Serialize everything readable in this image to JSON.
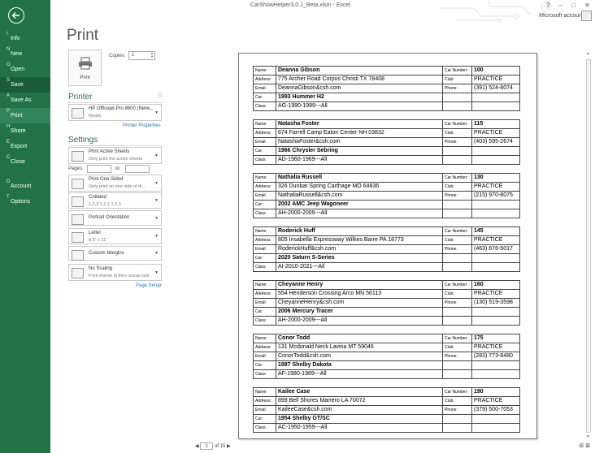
{
  "window": {
    "title": "CarShowHelper3.0.1_Beta.xlsm - Excel",
    "account": "Microsoft account",
    "controls": [
      "?",
      "–",
      "□",
      "✕"
    ]
  },
  "nav": {
    "items": [
      {
        "key": "I",
        "label": "Info"
      },
      {
        "key": "N",
        "label": "New"
      },
      {
        "key": "O",
        "label": "Open"
      },
      {
        "key": "S",
        "label": "Save"
      },
      {
        "key": "A",
        "label": "Save As"
      },
      {
        "key": "P",
        "label": "Print"
      },
      {
        "key": "H",
        "label": "Share"
      },
      {
        "key": "E",
        "label": "Export"
      },
      {
        "key": "C",
        "label": "Close"
      },
      {
        "key": "D",
        "label": "Account"
      },
      {
        "key": "T",
        "label": "Options"
      }
    ]
  },
  "print": {
    "title": "Print",
    "button_label": "Print",
    "copies_label": "Copies:",
    "copies_value": "1",
    "printer_heading": "Printer",
    "printer_name": "HP Officejet Pro 8600 (Netw...",
    "printer_status": "Ready",
    "printer_properties": "Printer Properties",
    "settings_heading": "Settings",
    "pages_label": "Pages:",
    "to_label": "to",
    "page_setup": "Page Setup",
    "settings": [
      {
        "t1": "Print Active Sheets",
        "t2": "Only print the active sheets"
      },
      {
        "t1": "Print One Sided",
        "t2": "Only print on one side of th..."
      },
      {
        "t1": "Collated",
        "t2": "1,2,3    1,2,3    1,2,3"
      },
      {
        "t1": "Portrait Orientation",
        "t2": ""
      },
      {
        "t1": "Letter",
        "t2": "8.5\" x 11\""
      },
      {
        "t1": "Custom Margins",
        "t2": ""
      },
      {
        "t1": "No Scaling",
        "t2": "Print sheets at their actual size"
      }
    ]
  },
  "preview": {
    "current_page": "1",
    "of_pages": "of 15",
    "labels": {
      "name": "Name:",
      "address": "Address:",
      "email": "Email:",
      "car": "Car:",
      "class": "Class:",
      "car_number": "Car Number:",
      "club": "Club:",
      "phone": "Phone:"
    },
    "records": [
      {
        "name": "Deanna Gibson",
        "address": "775 Archer Road Corpus Christi TX 78408",
        "email": "DeannaGibson&csh.com",
        "car": "1993 Hummer H2",
        "class": "AG-1990-1999---All",
        "car_number": "100",
        "club": "PRACTICE",
        "phone": "(391) 524-8074"
      },
      {
        "name": "Natasha Foster",
        "address": "674 Farrell Camp Eaton Center NH 03832",
        "email": "NatashaFoster&csh.com",
        "car": "1966 Chrysler Sebring",
        "class": "AD-1960-1969---All",
        "car_number": "115",
        "club": "PRACTICE",
        "phone": "(403) 595-2674"
      },
      {
        "name": "Nathalia Russell",
        "address": "326 Dunbar Spring Carthage MO 64836",
        "email": "NathaliaRussell&csh.com",
        "car": "2002 AMC Jeep Wagoneer",
        "class": "AH-2000-2009---All",
        "car_number": "130",
        "club": "PRACTICE",
        "phone": "(215) 970-8075"
      },
      {
        "name": "Roderick Huff",
        "address": "805 Insabella Expressway Wilkes Barre PA 18773",
        "email": "RoderickHuff&csh.com",
        "car": "2020 Saturn S-Series",
        "class": "AI-2010-2021---All",
        "car_number": "145",
        "club": "PRACTICE",
        "phone": "(463) 676-5017"
      },
      {
        "name": "Cheyanne Henry",
        "address": "554 Henderson Crossing Arco MN 56113",
        "email": "CheyanneHenry&csh.com",
        "car": "2006 Mercury Tracer",
        "class": "AH-2000-2009---All",
        "car_number": "160",
        "club": "PRACTICE",
        "phone": "(130) 519-3598"
      },
      {
        "name": "Conor Todd",
        "address": "131 Mcdonald Neck Lavina MT 59046",
        "email": "ConorTodd&csh.com",
        "car": "1987 Shelby Dakota",
        "class": "AF-1980-1989---All",
        "car_number": "175",
        "club": "PRACTICE",
        "phone": "(283) 773-8480"
      },
      {
        "name": "Kailee Case",
        "address": "899 Bell Shores Marrero LA 70072",
        "email": "KaileeCase&csh.com",
        "car": "1954 Shelby GT/SC",
        "class": "AC-1950-1959---All",
        "car_number": "190",
        "club": "PRACTICE",
        "phone": "(379) 500-7053"
      }
    ]
  }
}
